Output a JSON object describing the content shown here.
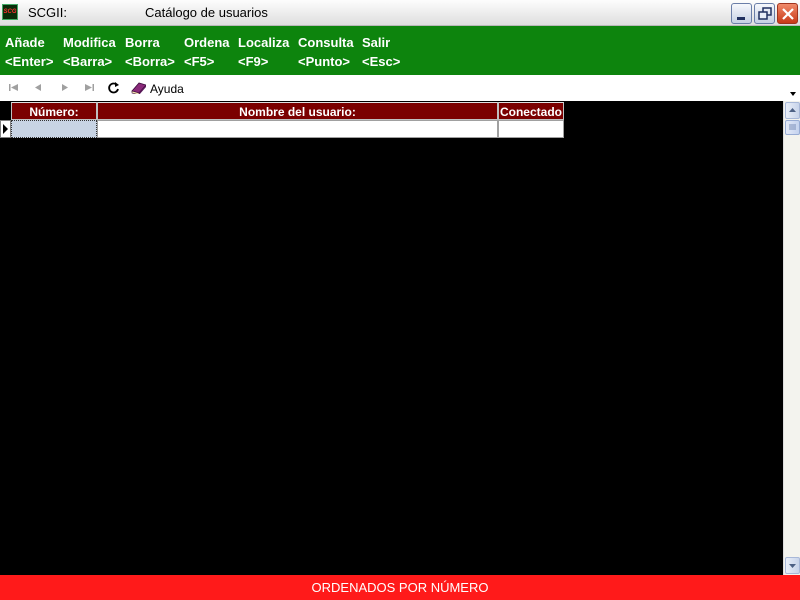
{
  "titlebar": {
    "app_icon_text": "SCG",
    "app_name": "SCGII:",
    "window_title": "Catálogo de usuarios",
    "buttons": [
      "minimize-icon",
      "restore-icon",
      "close-icon"
    ]
  },
  "menu": {
    "items": [
      {
        "label": "Añade",
        "key": "<Enter>"
      },
      {
        "label": "Modifica",
        "key": "<Barra>"
      },
      {
        "label": "Borra",
        "key": "<Borra>"
      },
      {
        "label": "Ordena",
        "key": "<F5>"
      },
      {
        "label": "Localiza",
        "key": "<F9>"
      },
      {
        "label": "Consulta",
        "key": "<Punto>"
      },
      {
        "label": "Salir",
        "key": "<Esc>"
      }
    ]
  },
  "toolbar": {
    "icons": [
      "first-record-icon",
      "previous-record-icon",
      "next-record-icon",
      "last-record-icon",
      "refresh-icon",
      "help-book-icon"
    ],
    "help_label": "Ayuda"
  },
  "grid": {
    "columns": [
      "Número:",
      "Nombre del usuario:",
      "Conectado"
    ],
    "rows": [
      [
        "",
        "",
        ""
      ]
    ]
  },
  "status": {
    "text": "ORDENADOS POR NÚMERO"
  },
  "colors": {
    "menu_bg": "#0d840d",
    "header_bg": "#7b0000",
    "status_bg": "#ff1a1a"
  }
}
